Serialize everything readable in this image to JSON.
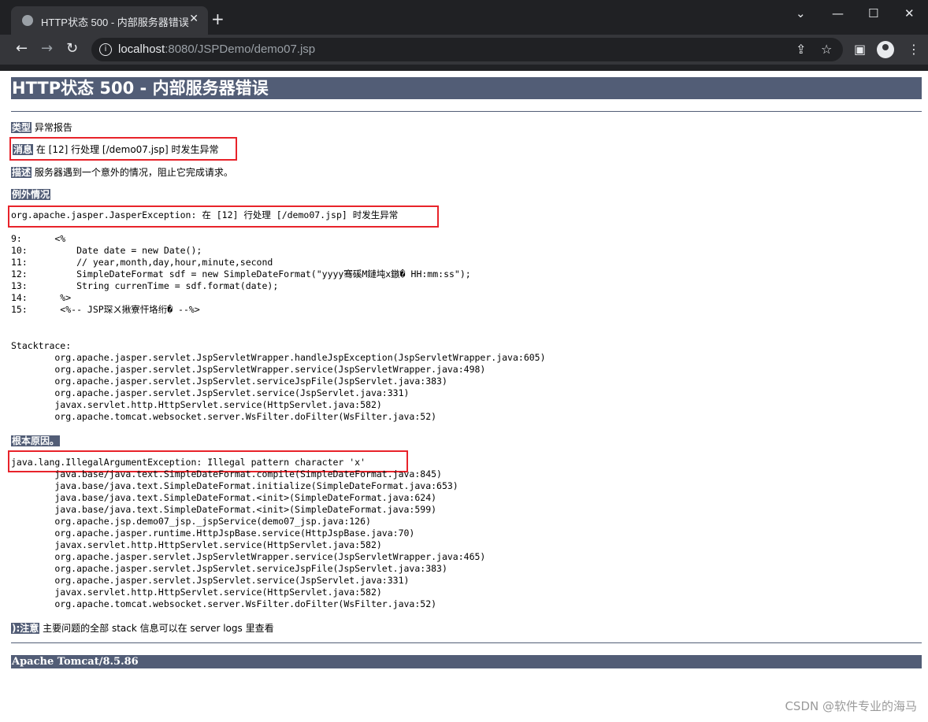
{
  "browser": {
    "tab_title": "HTTP状态 500 - 内部服务器错误",
    "url_host": "localhost",
    "url_path": ":8080/JSPDemo/demo07.jsp"
  },
  "page": {
    "heading": "HTTP状态 500 - 内部服务器错误",
    "type_label": "类型",
    "type_value": "异常报告",
    "message_label": "消息",
    "message_value": "在 [12] 行处理 [/demo07.jsp] 时发生异常",
    "description_label": "描述",
    "description_value": "服务器遇到一个意外的情况，阻止它完成请求。",
    "exception_label": "例外情况",
    "exception_line": "org.apache.jasper.JasperException: 在 [12] 行处理 [/demo07.jsp] 时发生异常",
    "source_lines": "9:      <%\n10:         Date date = new Date();\n11:         // year,month,day,hour,minute,second\n12:         SimpleDateFormat sdf = new SimpleDateFormat(\"yyyy骞磎M鏈坉x鏃� HH:mm:ss\");\n13:         String currenTime = sdf.format(date);\n14:      %>\n15:      <%-- JSP琛ㄨ揪寮忓垎绗� --%>",
    "stacktrace": "Stacktrace:\n        org.apache.jasper.servlet.JspServletWrapper.handleJspException(JspServletWrapper.java:605)\n        org.apache.jasper.servlet.JspServletWrapper.service(JspServletWrapper.java:498)\n        org.apache.jasper.servlet.JspServlet.serviceJspFile(JspServlet.java:383)\n        org.apache.jasper.servlet.JspServlet.service(JspServlet.java:331)\n        javax.servlet.http.HttpServlet.service(HttpServlet.java:582)\n        org.apache.tomcat.websocket.server.WsFilter.doFilter(WsFilter.java:52)",
    "root_cause_label": "根本原因。",
    "root_cause_line": "java.lang.IllegalArgumentException: Illegal pattern character 'x'",
    "root_cause_trace": "        java.base/java.text.SimpleDateFormat.compile(SimpleDateFormat.java:845)\n        java.base/java.text.SimpleDateFormat.initialize(SimpleDateFormat.java:653)\n        java.base/java.text.SimpleDateFormat.<init>(SimpleDateFormat.java:624)\n        java.base/java.text.SimpleDateFormat.<init>(SimpleDateFormat.java:599)\n        org.apache.jsp.demo07_jsp._jspService(demo07_jsp.java:126)\n        org.apache.jasper.runtime.HttpJspBase.service(HttpJspBase.java:70)\n        javax.servlet.http.HttpServlet.service(HttpServlet.java:582)\n        org.apache.jasper.servlet.JspServletWrapper.service(JspServletWrapper.java:465)\n        org.apache.jasper.servlet.JspServlet.serviceJspFile(JspServlet.java:383)\n        org.apache.jasper.servlet.JspServlet.service(JspServlet.java:331)\n        javax.servlet.http.HttpServlet.service(HttpServlet.java:582)\n        org.apache.tomcat.websocket.server.WsFilter.doFilter(WsFilter.java:52)",
    "note_label": "):注意",
    "note_value": "主要问题的全部 stack 信息可以在 server logs 里查看",
    "footer": "Apache Tomcat/8.5.86"
  },
  "watermark": "CSDN @软件专业的海马",
  "colors": {
    "header_bar": "#525d76",
    "highlight_box": "#e8232a",
    "browser_frame": "#202124"
  }
}
